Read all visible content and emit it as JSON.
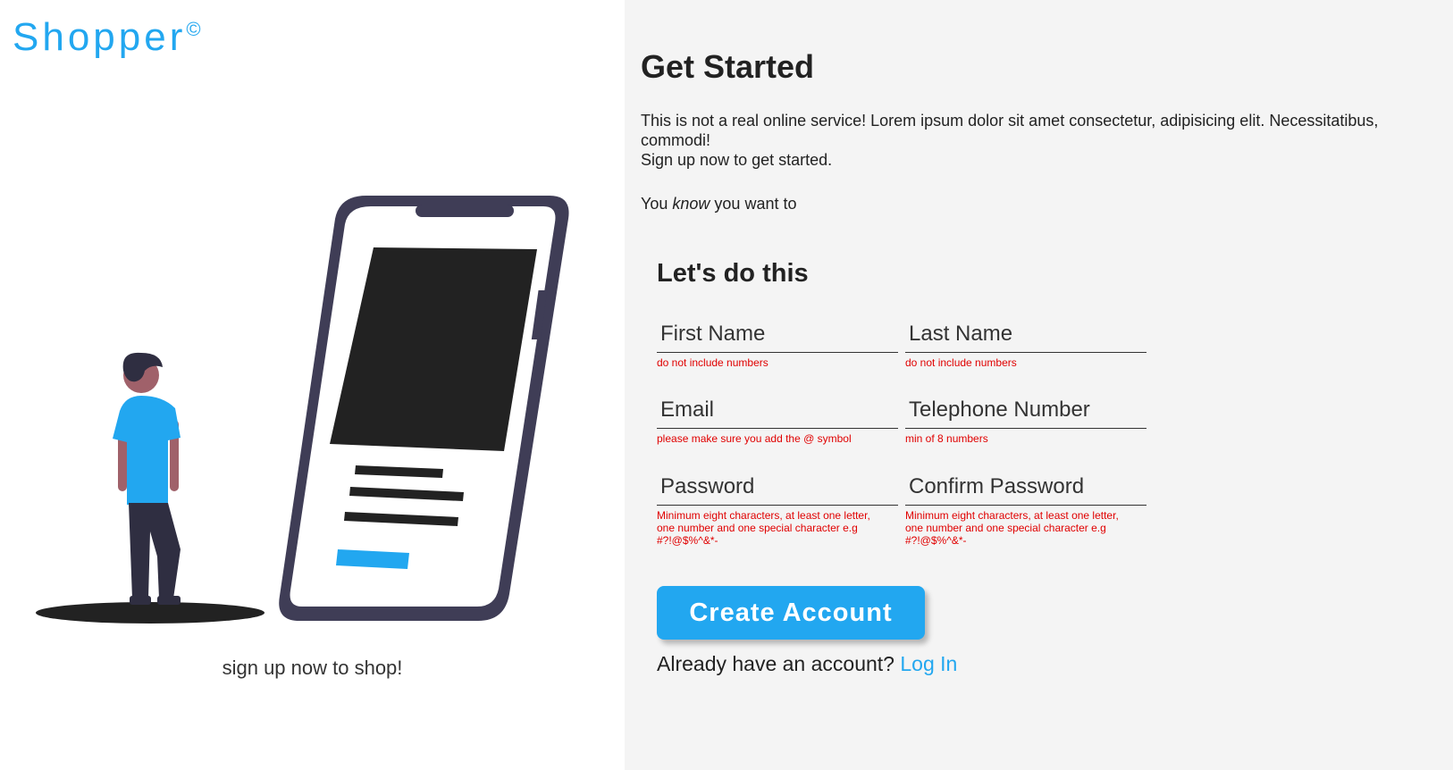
{
  "brand": {
    "name": "Shopper",
    "mark": "©",
    "color": "#22a7f0"
  },
  "left": {
    "tagline": "sign up now to shop!"
  },
  "right": {
    "heading": "Get Started",
    "intro_line1": "This is not a real online service! Lorem ipsum dolor sit amet consectetur, adipisicing elit. Necessitatibus, commodi!",
    "intro_line2": "Sign up now to get started.",
    "know_prefix": "You ",
    "know_word": "know",
    "know_suffix": " you want to"
  },
  "form": {
    "title": "Let's do this",
    "fields": {
      "first_name": {
        "placeholder": "First Name",
        "hint": "do not include numbers"
      },
      "last_name": {
        "placeholder": "Last Name",
        "hint": "do not include numbers"
      },
      "email": {
        "placeholder": "Email",
        "hint": "please make sure you add the @ symbol"
      },
      "telephone": {
        "placeholder": "Telephone Number",
        "hint": "min of 8 numbers"
      },
      "password": {
        "placeholder": "Password",
        "hint": "Minimum eight characters, at least one letter, one number and one special character e.g #?!@$%^&*-"
      },
      "confirm_password": {
        "placeholder": "Confirm Password",
        "hint": "Minimum eight characters, at least one letter, one number and one special character e.g #?!@$%^&*-"
      }
    },
    "submit_label": "Create Account",
    "login_prompt": "Already have an account?",
    "login_link": "Log In"
  },
  "colors": {
    "accent": "#22a7f0",
    "error": "#e00000",
    "panel_bg": "#f4f4f4"
  }
}
